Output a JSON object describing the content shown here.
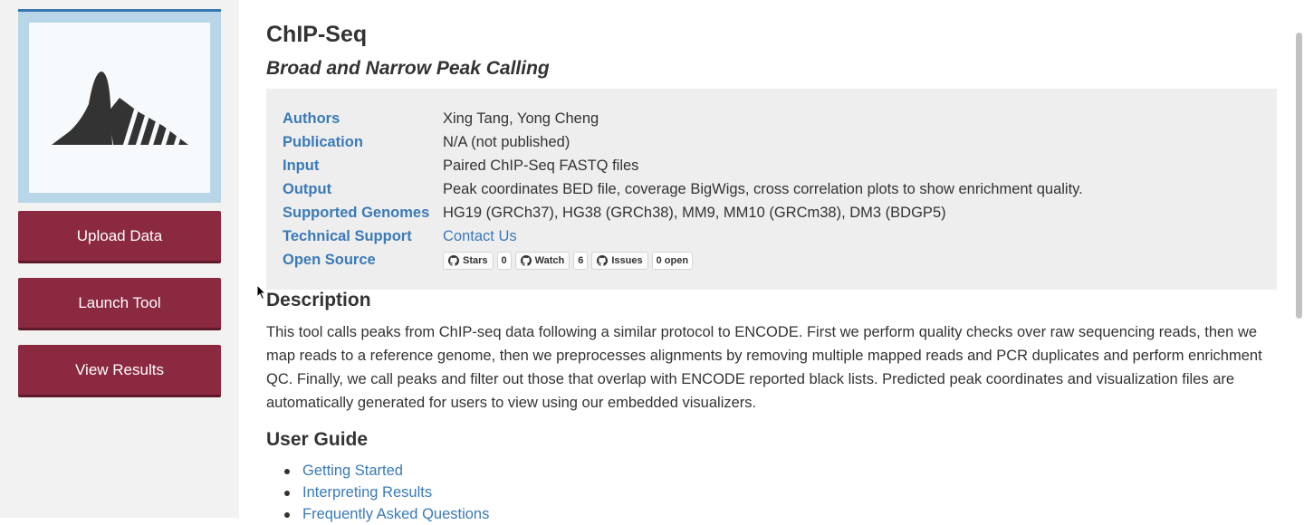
{
  "sidebar": {
    "buttons": {
      "upload": "Upload Data",
      "launch": "Launch Tool",
      "results": "View Results"
    }
  },
  "tool": {
    "title": "ChIP-Seq",
    "subtitle": "Broad and Narrow Peak Calling"
  },
  "meta": {
    "authors": {
      "label": "Authors",
      "value": "Xing Tang, Yong Cheng"
    },
    "publication": {
      "label": "Publication",
      "value": "N/A (not published)"
    },
    "input": {
      "label": "Input",
      "value": "Paired ChIP-Seq FASTQ files"
    },
    "output": {
      "label": "Output",
      "value": "Peak coordinates BED file, coverage BigWigs, cross correlation plots to show enrichment quality."
    },
    "genomes": {
      "label": "Supported Genomes",
      "value": "HG19 (GRCh37), HG38 (GRCh38), MM9, MM10 (GRCm38), DM3 (BDGP5)"
    },
    "support": {
      "label": "Technical Support",
      "value": "Contact Us"
    },
    "open_source": {
      "label": "Open Source",
      "stars_label": "Stars",
      "stars_count": "0",
      "watch_label": "Watch",
      "watch_count": "6",
      "issues_label": "Issues",
      "issues_count": "0 open"
    }
  },
  "description": {
    "heading": "Description",
    "text": "This tool calls peaks from ChIP-seq data following a similar protocol to ENCODE. First we perform quality checks over raw sequencing reads, then we map reads to a reference genome, then we preprocesses alignments by removing multiple mapped reads and PCR duplicates and perform enrichment QC. Finally, we call peaks and filter out those that overlap with ENCODE reported black lists. Predicted peak coordinates and visualization files are automatically generated for users to view using our embedded visualizers."
  },
  "user_guide": {
    "heading": "User Guide",
    "links": [
      "Getting Started",
      "Interpreting Results",
      "Frequently Asked Questions"
    ]
  },
  "colors": {
    "sidebar_button": "#8b2940",
    "link": "#3a7ab8",
    "logo_frame": "#b9d6e8",
    "meta_background": "#eeeeee"
  },
  "icons": {
    "logo": "peak-logo-icon",
    "badge": "github-icon",
    "cursor": "mouse-cursor-icon"
  }
}
